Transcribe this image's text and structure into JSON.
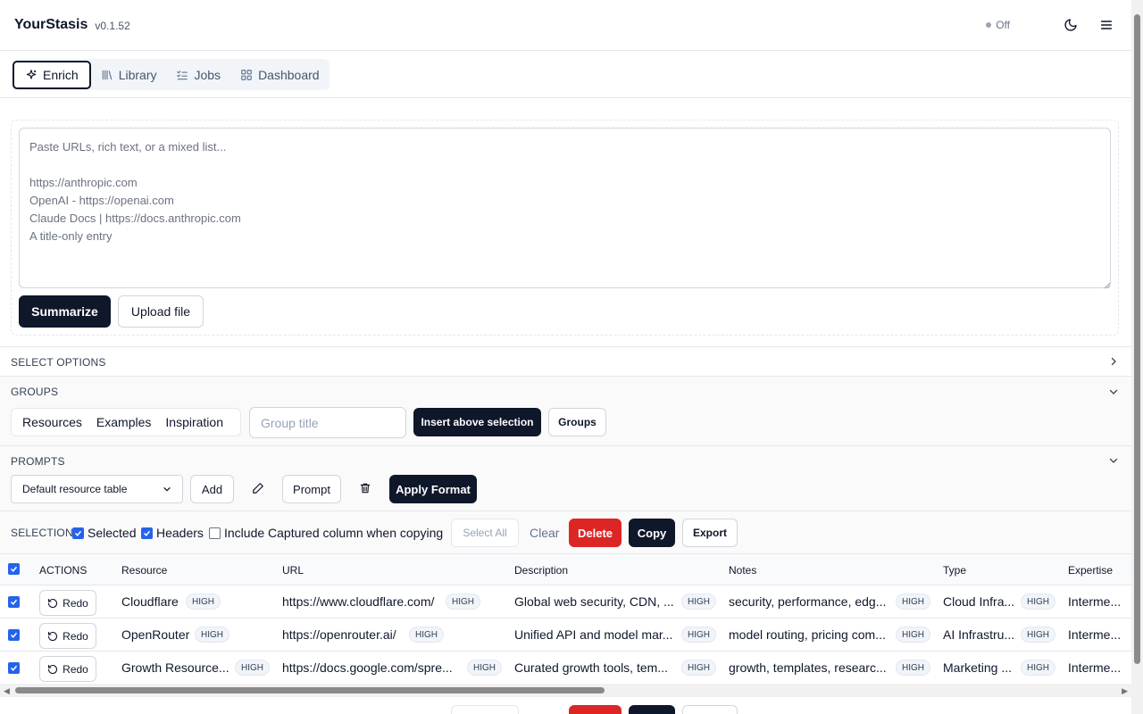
{
  "header": {
    "brand": "YourStasis",
    "version": "v0.1.52",
    "status": "Off",
    "theme_icon": "moon-icon",
    "menu_icon": "hamburger-menu-icon"
  },
  "tabs": [
    {
      "label": "Enrich",
      "icon": "sparkle-icon",
      "active": true
    },
    {
      "label": "Library",
      "icon": "library-icon",
      "active": false
    },
    {
      "label": "Jobs",
      "icon": "list-checks-icon",
      "active": false
    },
    {
      "label": "Dashboard",
      "icon": "grid-icon",
      "active": false
    }
  ],
  "enrich": {
    "placeholder": "Paste URLs, rich text, or a mixed list...\n\nhttps://anthropic.com\nOpenAI - https://openai.com\nClaude Docs | https://docs.anthropic.com\nA title-only entry",
    "summarize_label": "Summarize",
    "upload_label": "Upload file"
  },
  "select_options": {
    "title": "SELECT OPTIONS"
  },
  "groups": {
    "title": "GROUPS",
    "segments": [
      "Resources",
      "Examples",
      "Inspiration"
    ],
    "group_title_placeholder": "Group title",
    "insert_label": "Insert above selection",
    "groups_label": "Groups"
  },
  "prompts": {
    "title": "PROMPTS",
    "selected_prompt": "Default resource table",
    "add_label": "Add",
    "prompt_label": "Prompt",
    "apply_label": "Apply Format"
  },
  "selection": {
    "title": "SELECTION",
    "selected_label": "Selected",
    "headers_label": "Headers",
    "include_captured_label": "Include Captured column when copying",
    "select_all_label": "Select All",
    "clear_label": "Clear",
    "delete_label": "Delete",
    "copy_label": "Copy",
    "export_label": "Export"
  },
  "table": {
    "columns": [
      "ACTIONS",
      "Resource",
      "URL",
      "Description",
      "Notes",
      "Type",
      "Expertise"
    ],
    "redo_label": "Redo",
    "badge": "HIGH",
    "rows": [
      {
        "resource": "Cloudflare",
        "url": "https://www.cloudflare.com/",
        "description": "Global web security, CDN, ...",
        "notes": "security, performance, edg...",
        "type": "Cloud Infra...",
        "expertise": "Interme..."
      },
      {
        "resource": "OpenRouter",
        "url": "https://openrouter.ai/",
        "description": "Unified API and model mar...",
        "notes": "model routing, pricing com...",
        "type": "AI Infrastru...",
        "expertise": "Interme..."
      },
      {
        "resource": "Growth Resource...",
        "url": "https://docs.google.com/spre...",
        "description": "Curated growth tools, tem...",
        "notes": "growth, templates, researc...",
        "type": "Marketing ...",
        "expertise": "Interme..."
      }
    ]
  },
  "colors": {
    "primary": "#0f172a",
    "danger": "#dc2626",
    "checkbox": "#2563eb",
    "border": "#e5e7eb"
  }
}
